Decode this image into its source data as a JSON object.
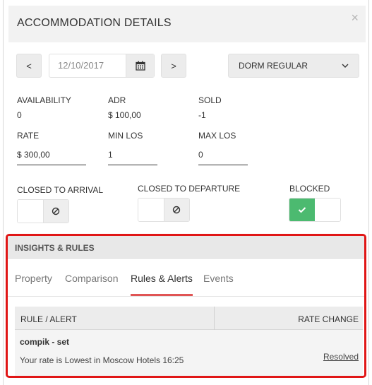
{
  "modal": {
    "title": "ACCOMMODATION DETAILS",
    "close_symbol": "×"
  },
  "toolbar": {
    "prev_label": "<",
    "next_label": ">",
    "date_value": "12/10/2017",
    "calendar_icon": "calendar-icon",
    "room_type": "DORM REGULAR",
    "room_type_chevron": "chevron-down-icon"
  },
  "stats": {
    "availability_label": "AVAILABILITY",
    "availability_value": "0",
    "adr_label": "ADR",
    "adr_value": "$ 100,00",
    "sold_label": "SOLD",
    "sold_value": "-1"
  },
  "editable": {
    "rate_label": "RATE",
    "rate_value": "$ 300,00",
    "min_los_label": "MIN LOS",
    "min_los_value": "1",
    "max_los_label": "MAX LOS",
    "max_los_value": "0"
  },
  "restrictions": {
    "cta_label": "CLOSED TO ARRIVAL",
    "ctd_label": "CLOSED TO DEPARTURE",
    "blocked_label": "BLOCKED",
    "cta_state": "off",
    "ctd_state": "off",
    "blocked_state": "on"
  },
  "insights": {
    "title": "INSIGHTS & RULES",
    "tabs": [
      {
        "label": "Property",
        "active": false
      },
      {
        "label": "Comparison",
        "active": false
      },
      {
        "label": "Rules & Alerts",
        "active": true
      },
      {
        "label": "Events",
        "active": false
      }
    ],
    "table": {
      "headers": [
        "RULE / ALERT",
        "RATE CHANGE"
      ],
      "rows": [
        {
          "name": "compik - set",
          "message": "Your rate is Lowest in Moscow Hotels 16:25",
          "action": "Resolved"
        }
      ]
    }
  },
  "colors": {
    "accent_red": "#e01616",
    "toggle_on": "#4cba70",
    "tab_underline": "#e05555"
  }
}
